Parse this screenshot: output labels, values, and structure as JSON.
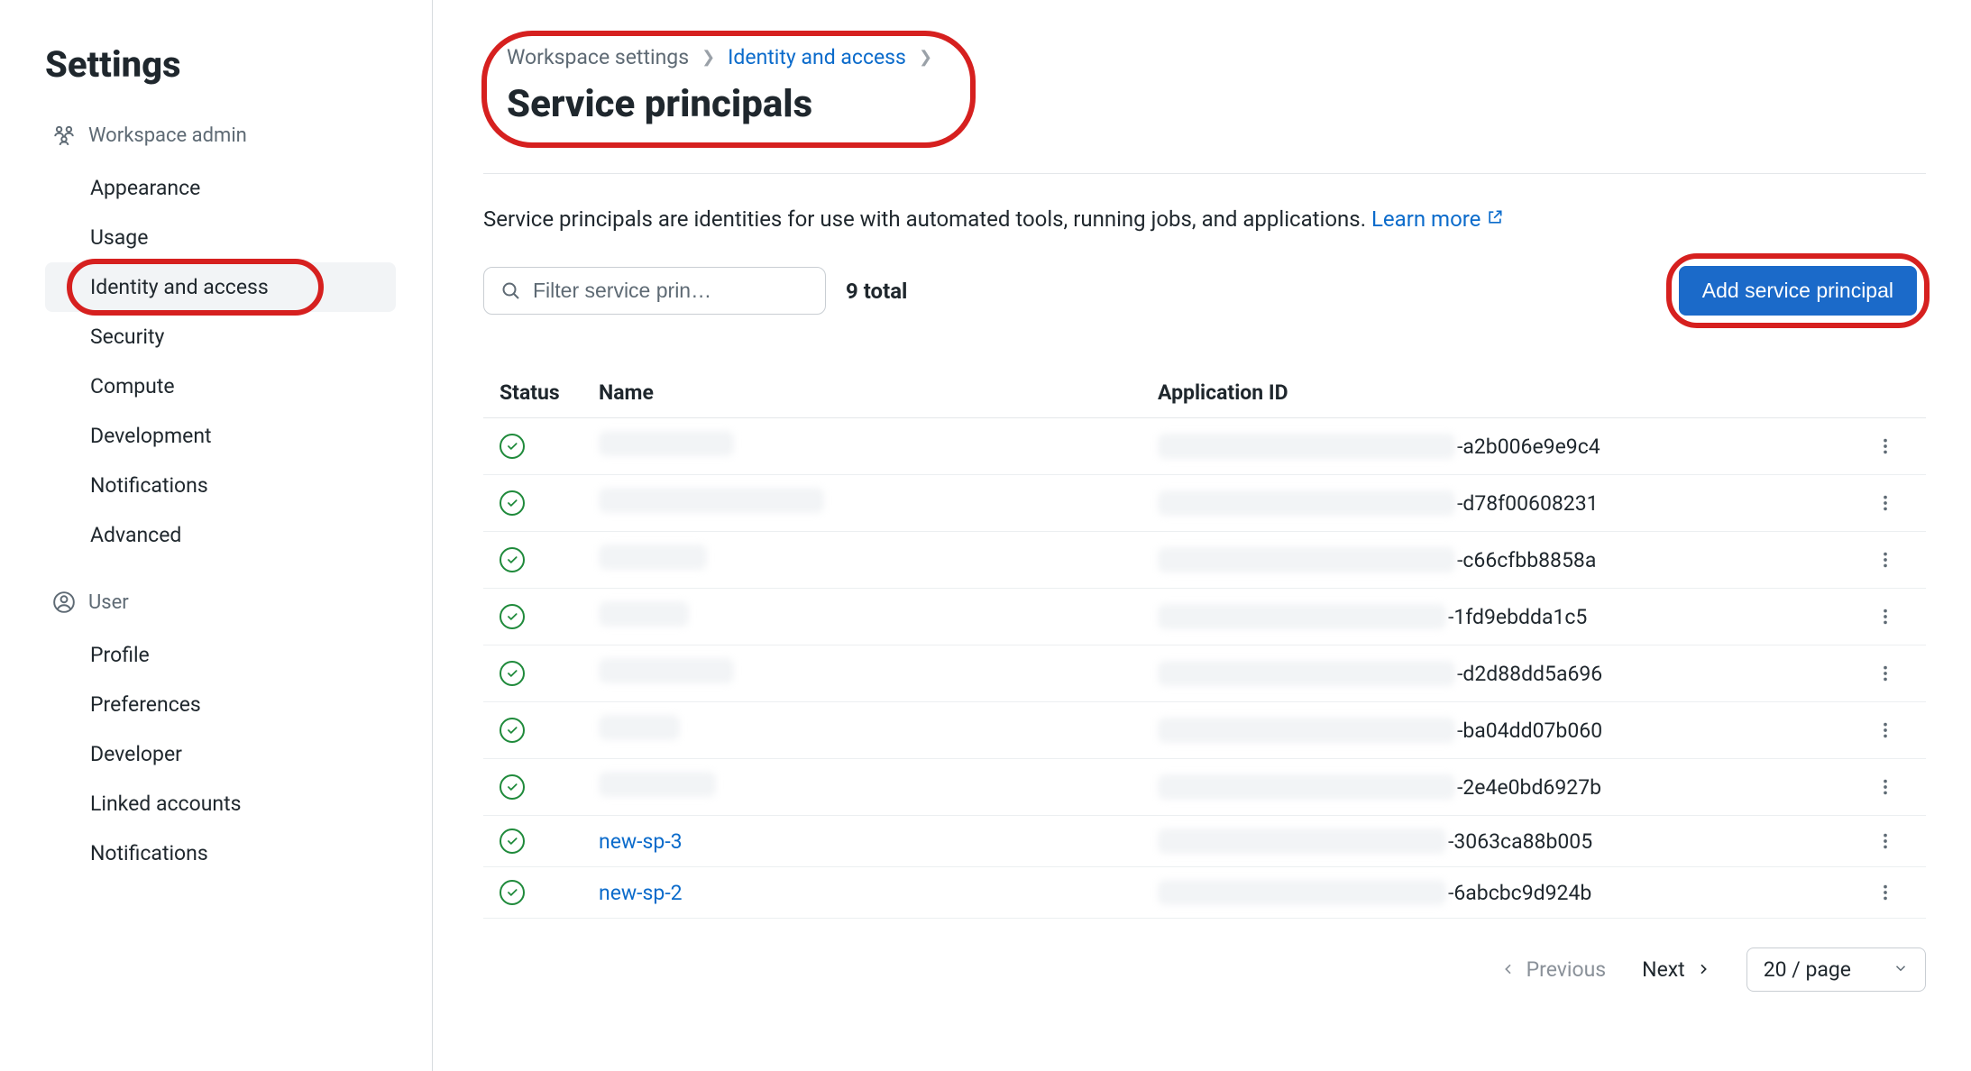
{
  "sidebar": {
    "title": "Settings",
    "sections": [
      {
        "header": "Workspace admin",
        "icon": "workspace-admin-icon",
        "items": [
          {
            "label": "Appearance",
            "active": false
          },
          {
            "label": "Usage",
            "active": false
          },
          {
            "label": "Identity and access",
            "active": true,
            "highlighted": true
          },
          {
            "label": "Security",
            "active": false
          },
          {
            "label": "Compute",
            "active": false
          },
          {
            "label": "Development",
            "active": false
          },
          {
            "label": "Notifications",
            "active": false
          },
          {
            "label": "Advanced",
            "active": false
          }
        ]
      },
      {
        "header": "User",
        "icon": "user-icon",
        "items": [
          {
            "label": "Profile",
            "active": false
          },
          {
            "label": "Preferences",
            "active": false
          },
          {
            "label": "Developer",
            "active": false
          },
          {
            "label": "Linked accounts",
            "active": false
          },
          {
            "label": "Notifications",
            "active": false
          }
        ]
      }
    ]
  },
  "breadcrumb": {
    "part1": "Workspace settings",
    "part2": "Identity and access",
    "highlighted": true
  },
  "page_title": "Service principals",
  "description": {
    "text": "Service principals are identities for use with automated tools, running jobs, and applications. ",
    "learn_more": "Learn more"
  },
  "toolbar": {
    "filter_placeholder": "Filter service prin…",
    "total_label": "9 total",
    "add_button": "Add service principal",
    "add_highlighted": true
  },
  "table": {
    "columns": {
      "status": "Status",
      "name": "Name",
      "app_id": "Application ID"
    },
    "rows": [
      {
        "status": "active",
        "name_redacted": true,
        "name_blur_width": 150,
        "app_prefix_blur_width": 330,
        "app_suffix": "-a2b006e9e9c4"
      },
      {
        "status": "active",
        "name_redacted": true,
        "name_blur_width": 250,
        "app_prefix_blur_width": 330,
        "app_suffix": "-d78f00608231"
      },
      {
        "status": "active",
        "name_redacted": true,
        "name_blur_width": 120,
        "app_prefix_blur_width": 330,
        "app_suffix": "-c66cfbb8858a"
      },
      {
        "status": "active",
        "name_redacted": true,
        "name_blur_width": 100,
        "app_prefix_blur_width": 320,
        "app_suffix": "-1fd9ebdda1c5"
      },
      {
        "status": "active",
        "name_redacted": true,
        "name_blur_width": 150,
        "app_prefix_blur_width": 330,
        "app_suffix": "-d2d88dd5a696"
      },
      {
        "status": "active",
        "name_redacted": true,
        "name_blur_width": 90,
        "app_prefix_blur_width": 330,
        "app_suffix": "-ba04dd07b060"
      },
      {
        "status": "active",
        "name_redacted": true,
        "name_blur_width": 130,
        "app_prefix_blur_width": 330,
        "app_suffix": "-2e4e0bd6927b"
      },
      {
        "status": "active",
        "name_redacted": false,
        "name": "new-sp-3",
        "app_prefix_blur_width": 320,
        "app_suffix": "-3063ca88b005"
      },
      {
        "status": "active",
        "name_redacted": false,
        "name": "new-sp-2",
        "app_prefix_blur_width": 320,
        "app_suffix": "-6abcbc9d924b"
      }
    ]
  },
  "pagination": {
    "previous": "Previous",
    "next": "Next",
    "page_size": "20 / page"
  }
}
